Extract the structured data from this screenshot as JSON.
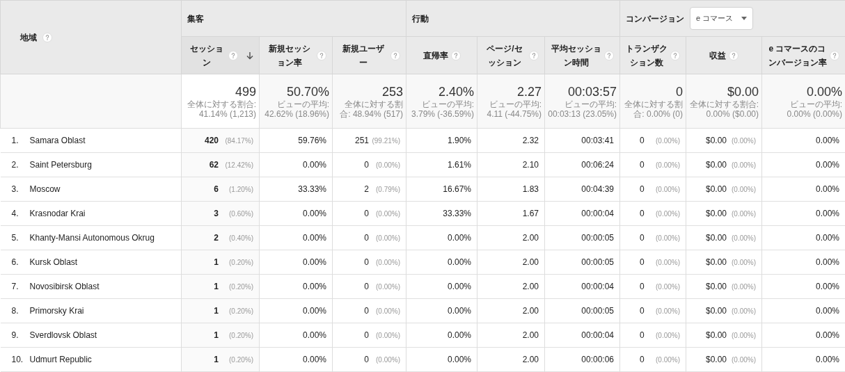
{
  "dimension": {
    "label": "地域"
  },
  "groups": [
    {
      "label": "集客"
    },
    {
      "label": "行動"
    },
    {
      "label": "コンバージョン",
      "dropdown": "e コマース"
    }
  ],
  "columns": [
    {
      "label": "セッション",
      "sorted": true
    },
    {
      "label": "新規セッション率",
      "sorted": false
    },
    {
      "label": "新規ユーザー",
      "sorted": false
    },
    {
      "label": "直帰率",
      "sorted": false
    },
    {
      "label": "ページ/セッション",
      "sorted": false
    },
    {
      "label": "平均セッション時間",
      "sorted": false
    },
    {
      "label": "トランザクション数",
      "sorted": false
    },
    {
      "label": "収益",
      "sorted": false
    },
    {
      "label": "e コマースのコンバージョン率",
      "sorted": false
    }
  ],
  "totals": [
    {
      "value": "499",
      "note": "全体に対する割合: 41.14% (1,213)"
    },
    {
      "value": "50.70%",
      "note": "ビューの平均: 42.62% (18.96%)"
    },
    {
      "value": "253",
      "note": "全体に対する割合: 48.94% (517)"
    },
    {
      "value": "2.40%",
      "note": "ビューの平均: 3.79% (-36.59%)"
    },
    {
      "value": "2.27",
      "note": "ビューの平均: 4.11 (-44.75%)"
    },
    {
      "value": "00:03:57",
      "note": "ビューの平均: 00:03:13 (23.05%)"
    },
    {
      "value": "0",
      "note": "全体に対する割合: 0.00% (0)"
    },
    {
      "value": "$0.00",
      "note": "全体に対する割合: 0.00% ($0.00)"
    },
    {
      "value": "0.00%",
      "note": "ビューの平均: 0.00% (0.00%)"
    }
  ],
  "rows": [
    {
      "index": "1.",
      "region": "Samara Oblast",
      "cells": [
        {
          "value": "420",
          "share": "(84.17%)"
        },
        {
          "value": "59.76%"
        },
        {
          "value": "251",
          "share": "(99.21%)"
        },
        {
          "value": "1.90%"
        },
        {
          "value": "2.32"
        },
        {
          "value": "00:03:41"
        },
        {
          "value": "0",
          "share": "(0.00%)"
        },
        {
          "value": "$0.00",
          "share": "(0.00%)"
        },
        {
          "value": "0.00%"
        }
      ]
    },
    {
      "index": "2.",
      "region": "Saint Petersburg",
      "cells": [
        {
          "value": "62",
          "share": "(12.42%)"
        },
        {
          "value": "0.00%"
        },
        {
          "value": "0",
          "share": "(0.00%)"
        },
        {
          "value": "1.61%"
        },
        {
          "value": "2.10"
        },
        {
          "value": "00:06:24"
        },
        {
          "value": "0",
          "share": "(0.00%)"
        },
        {
          "value": "$0.00",
          "share": "(0.00%)"
        },
        {
          "value": "0.00%"
        }
      ]
    },
    {
      "index": "3.",
      "region": "Moscow",
      "cells": [
        {
          "value": "6",
          "share": "(1.20%)"
        },
        {
          "value": "33.33%"
        },
        {
          "value": "2",
          "share": "(0.79%)"
        },
        {
          "value": "16.67%"
        },
        {
          "value": "1.83"
        },
        {
          "value": "00:04:39"
        },
        {
          "value": "0",
          "share": "(0.00%)"
        },
        {
          "value": "$0.00",
          "share": "(0.00%)"
        },
        {
          "value": "0.00%"
        }
      ]
    },
    {
      "index": "4.",
      "region": "Krasnodar Krai",
      "cells": [
        {
          "value": "3",
          "share": "(0.60%)"
        },
        {
          "value": "0.00%"
        },
        {
          "value": "0",
          "share": "(0.00%)"
        },
        {
          "value": "33.33%"
        },
        {
          "value": "1.67"
        },
        {
          "value": "00:00:04"
        },
        {
          "value": "0",
          "share": "(0.00%)"
        },
        {
          "value": "$0.00",
          "share": "(0.00%)"
        },
        {
          "value": "0.00%"
        }
      ]
    },
    {
      "index": "5.",
      "region": "Khanty-Mansi Autonomous Okrug",
      "cells": [
        {
          "value": "2",
          "share": "(0.40%)"
        },
        {
          "value": "0.00%"
        },
        {
          "value": "0",
          "share": "(0.00%)"
        },
        {
          "value": "0.00%"
        },
        {
          "value": "2.00"
        },
        {
          "value": "00:00:05"
        },
        {
          "value": "0",
          "share": "(0.00%)"
        },
        {
          "value": "$0.00",
          "share": "(0.00%)"
        },
        {
          "value": "0.00%"
        }
      ]
    },
    {
      "index": "6.",
      "region": "Kursk Oblast",
      "cells": [
        {
          "value": "1",
          "share": "(0.20%)"
        },
        {
          "value": "0.00%"
        },
        {
          "value": "0",
          "share": "(0.00%)"
        },
        {
          "value": "0.00%"
        },
        {
          "value": "2.00"
        },
        {
          "value": "00:00:05"
        },
        {
          "value": "0",
          "share": "(0.00%)"
        },
        {
          "value": "$0.00",
          "share": "(0.00%)"
        },
        {
          "value": "0.00%"
        }
      ]
    },
    {
      "index": "7.",
      "region": "Novosibirsk Oblast",
      "cells": [
        {
          "value": "1",
          "share": "(0.20%)"
        },
        {
          "value": "0.00%"
        },
        {
          "value": "0",
          "share": "(0.00%)"
        },
        {
          "value": "0.00%"
        },
        {
          "value": "2.00"
        },
        {
          "value": "00:00:04"
        },
        {
          "value": "0",
          "share": "(0.00%)"
        },
        {
          "value": "$0.00",
          "share": "(0.00%)"
        },
        {
          "value": "0.00%"
        }
      ]
    },
    {
      "index": "8.",
      "region": "Primorsky Krai",
      "cells": [
        {
          "value": "1",
          "share": "(0.20%)"
        },
        {
          "value": "0.00%"
        },
        {
          "value": "0",
          "share": "(0.00%)"
        },
        {
          "value": "0.00%"
        },
        {
          "value": "2.00"
        },
        {
          "value": "00:00:05"
        },
        {
          "value": "0",
          "share": "(0.00%)"
        },
        {
          "value": "$0.00",
          "share": "(0.00%)"
        },
        {
          "value": "0.00%"
        }
      ]
    },
    {
      "index": "9.",
      "region": "Sverdlovsk Oblast",
      "cells": [
        {
          "value": "1",
          "share": "(0.20%)"
        },
        {
          "value": "0.00%"
        },
        {
          "value": "0",
          "share": "(0.00%)"
        },
        {
          "value": "0.00%"
        },
        {
          "value": "2.00"
        },
        {
          "value": "00:00:04"
        },
        {
          "value": "0",
          "share": "(0.00%)"
        },
        {
          "value": "$0.00",
          "share": "(0.00%)"
        },
        {
          "value": "0.00%"
        }
      ]
    },
    {
      "index": "10.",
      "region": "Udmurt Republic",
      "cells": [
        {
          "value": "1",
          "share": "(0.20%)"
        },
        {
          "value": "0.00%"
        },
        {
          "value": "0",
          "share": "(0.00%)"
        },
        {
          "value": "0.00%"
        },
        {
          "value": "2.00"
        },
        {
          "value": "00:00:06"
        },
        {
          "value": "0",
          "share": "(0.00%)"
        },
        {
          "value": "$0.00",
          "share": "(0.00%)"
        },
        {
          "value": "0.00%"
        }
      ]
    }
  ]
}
